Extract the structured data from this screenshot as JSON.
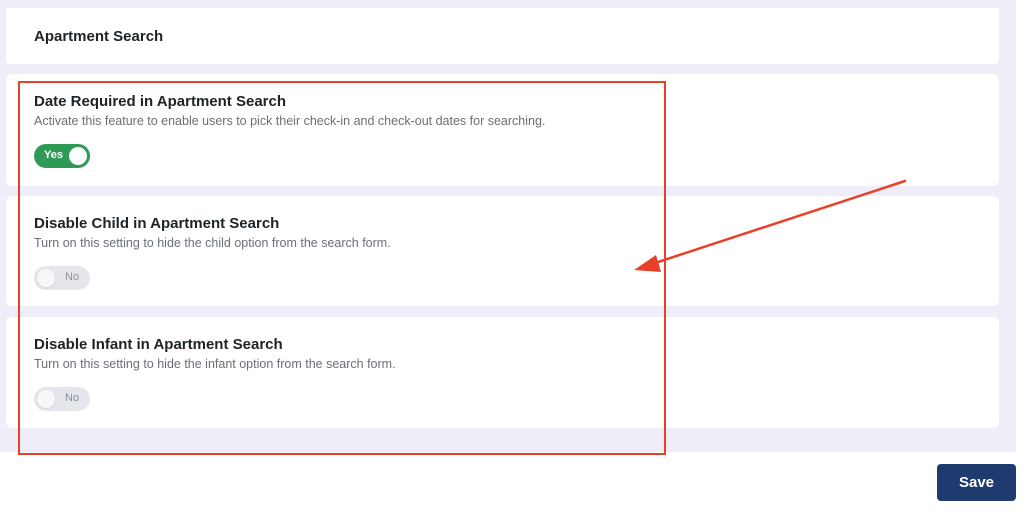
{
  "header": {
    "title": "Apartment Search"
  },
  "options": [
    {
      "title": "Date Required in Apartment Search",
      "description": "Activate this feature to enable users to pick their check-in and check-out dates for searching.",
      "toggle_label": "Yes",
      "enabled": true
    },
    {
      "title": "Disable Child in Apartment Search",
      "description": "Turn on this setting to hide the child option from the search form.",
      "toggle_label": "No",
      "enabled": false
    },
    {
      "title": "Disable Infant in Apartment Search",
      "description": "Turn on this setting to hide the infant option from the search form.",
      "toggle_label": "No",
      "enabled": false
    }
  ],
  "save_label": "Save",
  "colors": {
    "toggle_on": "#2e9a56",
    "toggle_off": "#e4e6ec",
    "annotation": "#e8412a",
    "save_button": "#1e3a6e",
    "panel_background": "#efeef8"
  }
}
